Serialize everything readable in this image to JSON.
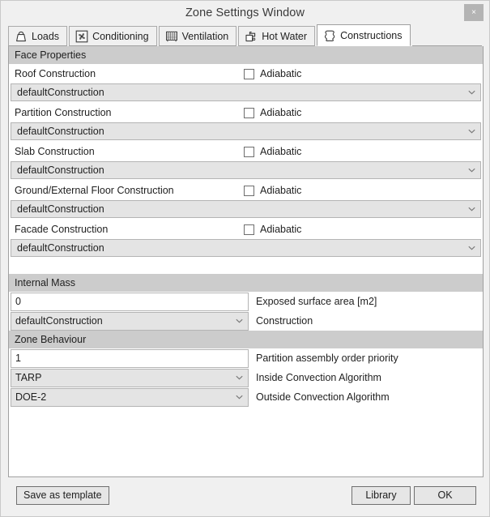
{
  "window": {
    "title": "Zone Settings Window",
    "close_label": "×"
  },
  "tabs": [
    {
      "label": "Loads",
      "icon": "weight-icon",
      "active": false
    },
    {
      "label": "Conditioning",
      "icon": "fan-icon",
      "active": false
    },
    {
      "label": "Ventilation",
      "icon": "vent-grille-icon",
      "active": false
    },
    {
      "label": "Hot Water",
      "icon": "faucet-icon",
      "active": false
    },
    {
      "label": "Constructions",
      "icon": "hide-outline-icon",
      "active": true
    }
  ],
  "face_properties": {
    "header": "Face Properties",
    "checkbox_label": "Adiabatic",
    "rows": [
      {
        "label": "Roof Construction",
        "checked": false,
        "value": "defaultConstruction"
      },
      {
        "label": "Partition Construction",
        "checked": false,
        "value": "defaultConstruction"
      },
      {
        "label": "Slab Construction",
        "checked": false,
        "value": "defaultConstruction"
      },
      {
        "label": "Ground/External Floor Construction",
        "checked": false,
        "value": "defaultConstruction"
      },
      {
        "label": "Facade Construction",
        "checked": false,
        "value": "defaultConstruction"
      }
    ]
  },
  "internal_mass": {
    "header": "Internal Mass",
    "rows": [
      {
        "type": "input",
        "value": "0",
        "label": "Exposed surface area [m2]"
      },
      {
        "type": "combo",
        "value": "defaultConstruction",
        "label": "Construction"
      }
    ]
  },
  "zone_behaviour": {
    "header": "Zone Behaviour",
    "rows": [
      {
        "type": "input",
        "value": "1",
        "label": "Partition assembly order priority"
      },
      {
        "type": "combo",
        "value": "TARP",
        "label": "Inside Convection Algorithm"
      },
      {
        "type": "combo",
        "value": "DOE-2",
        "label": "Outside Convection Algorithm"
      }
    ]
  },
  "footer": {
    "save_label": "Save as template",
    "library_label": "Library",
    "ok_label": "OK"
  },
  "colors": {
    "window_bg": "#f0f0f0",
    "panel_bg": "#ffffff",
    "section_header_bg": "#cccccc",
    "combo_bg": "#e4e4e4",
    "border": "#a0a0a0",
    "close_bg": "#b4b4b4"
  }
}
